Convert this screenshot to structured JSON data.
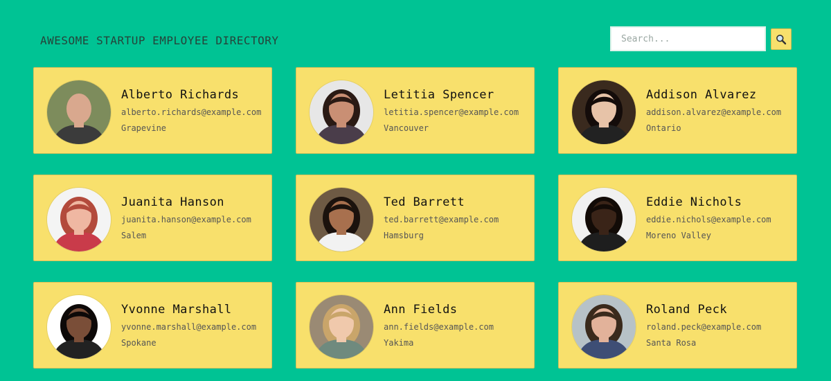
{
  "header": {
    "title": "AWESOME STARTUP EMPLOYEE DIRECTORY"
  },
  "search": {
    "placeholder": "Search...",
    "value": "",
    "button_icon": "search-icon"
  },
  "colors": {
    "background": "#00c394",
    "card": "#f8e06c",
    "card_border": "#d9c15a"
  },
  "employees": [
    {
      "name": "Alberto Richards",
      "email": "alberto.richards@example.com",
      "city": "Grapevine",
      "avatar": {
        "bg": "#7d8c5c",
        "skin": "#d9a88e",
        "hair": "#6e5b4b",
        "shirt": "#3b3b3b",
        "bald": true
      }
    },
    {
      "name": "Letitia Spencer",
      "email": "letitia.spencer@example.com",
      "city": "Vancouver",
      "avatar": {
        "bg": "#e7e7e7",
        "skin": "#c98f74",
        "hair": "#2a1a14",
        "shirt": "#4a3d4a",
        "bald": false
      }
    },
    {
      "name": "Addison Alvarez",
      "email": "addison.alvarez@example.com",
      "city": "Ontario",
      "avatar": {
        "bg": "#3a2a1e",
        "skin": "#e7c3a8",
        "hair": "#140c0a",
        "shirt": "#222222",
        "bald": false
      }
    },
    {
      "name": "Juanita Hanson",
      "email": "juanita.hanson@example.com",
      "city": "Salem",
      "avatar": {
        "bg": "#f4f4f4",
        "skin": "#efb7a2",
        "hair": "#b34a3c",
        "shirt": "#c93b4a",
        "bald": false
      }
    },
    {
      "name": "Ted Barrett",
      "email": "ted.barrett@example.com",
      "city": "Hamsburg",
      "avatar": {
        "bg": "#6e5a44",
        "skin": "#a8704e",
        "hair": "#1b120d",
        "shirt": "#f2f2f2",
        "bald": false
      }
    },
    {
      "name": "Eddie Nichols",
      "email": "eddie.nichols@example.com",
      "city": "Moreno Valley",
      "avatar": {
        "bg": "#f1f1f1",
        "skin": "#3a2418",
        "hair": "#120b07",
        "shirt": "#1e1e1e",
        "bald": false
      }
    },
    {
      "name": "Yvonne Marshall",
      "email": "yvonne.marshall@example.com",
      "city": "Spokane",
      "avatar": {
        "bg": "#ffffff",
        "skin": "#7a4e38",
        "hair": "#0d0908",
        "shirt": "#222222",
        "bald": false
      }
    },
    {
      "name": "Ann Fields",
      "email": "ann.fields@example.com",
      "city": "Yakima",
      "avatar": {
        "bg": "#9a8a74",
        "skin": "#f0c9ac",
        "hair": "#c9a56a",
        "shirt": "#6f8a7e",
        "bald": false
      }
    },
    {
      "name": "Roland Peck",
      "email": "roland.peck@example.com",
      "city": "Santa Rosa",
      "avatar": {
        "bg": "#b7c2c7",
        "skin": "#e2b29a",
        "hair": "#3a2a1c",
        "shirt": "#3e4e75",
        "bald": false
      }
    }
  ]
}
